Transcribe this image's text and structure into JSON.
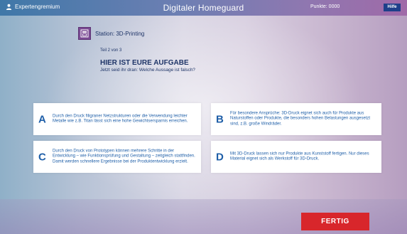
{
  "header": {
    "user_label": "Expertengremium",
    "title": "Digitaler Homeguard",
    "points": "Punkte: 0000",
    "help_label": "Hilfe"
  },
  "station": {
    "label": "Station: 3D-Printing",
    "icon": "3d-printer-icon"
  },
  "task": {
    "part": "Teil 2 von 3",
    "heading": "HIER IST EURE AUFGABE",
    "question": "Jetzt seid ihr dran: Welche Aussage ist falsch?"
  },
  "answers": [
    {
      "letter": "A",
      "text": "Durch den Druck filigraner Netzstrukturen oder die Verwendung leichter Metalle wie z.B. Titan lässt sich eine hohe Gewichtsersparnis erreichen."
    },
    {
      "letter": "B",
      "text": "Für besondere Ansprüche: 3D-Druck eignet sich auch für Produkte aus Naturstoffen oder Produkte, die besonders hohen Belastungen ausgesetzt sind, z.B. große Windräder."
    },
    {
      "letter": "C",
      "text": "Durch den Druck von Prototypen können mehrere Schritte in der Entwicklung – wie Funktionsprüfung und Gestaltung – zeitgleich stattfinden. Damit werden schnellere Ergebnisse bei der Produktentwicklung erzielt."
    },
    {
      "letter": "D",
      "text": "Mit 3D-Druck lassen sich nur Produkte aus Kunststoff fertigen. Nur dieses Material eignet sich als Werkstoff für 3D-Druck."
    }
  ],
  "footer": {
    "done_label": "FERTIG"
  },
  "colors": {
    "accent_blue": "#1f5fa8",
    "station_purple": "#7a4a93",
    "done_red": "#d8262b",
    "help_blue": "#1e3f8a"
  }
}
